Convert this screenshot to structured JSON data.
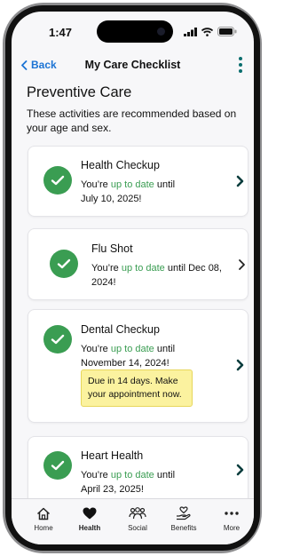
{
  "status": {
    "time": "1:47"
  },
  "nav": {
    "back_label": "Back",
    "title": "My Care Checklist"
  },
  "section": {
    "title": "Preventive Care",
    "intro": "These activities are recommended based on your age and sex."
  },
  "cards": [
    {
      "title": "Health Checkup",
      "status_prefix": "You’re ",
      "status_highlight": "up to date",
      "status_suffix": " until",
      "date": "July 10, 2025!"
    },
    {
      "title": "Flu Shot",
      "status_prefix": "You’re ",
      "status_highlight": "up to date",
      "status_suffix": " until Dec 08,",
      "date": "2024!"
    },
    {
      "title": "Dental Checkup",
      "status_prefix": "You’re ",
      "status_highlight": "up to date",
      "status_suffix": " until",
      "date": "November 14, 2024!",
      "due_line1": "Due in 14 days. Make",
      "due_line2": "your appointment now."
    },
    {
      "title": "Heart Health",
      "status_prefix": "You’re ",
      "status_highlight": "up to date",
      "status_suffix": " until",
      "date": "April 23, 2025!"
    }
  ],
  "tabs": [
    {
      "label": "Home",
      "icon": "home-icon"
    },
    {
      "label": "Health",
      "icon": "heart-icon",
      "active": true
    },
    {
      "label": "Social",
      "icon": "people-icon"
    },
    {
      "label": "Benefits",
      "icon": "hand-heart-icon"
    },
    {
      "label": "More",
      "icon": "more-icon"
    }
  ],
  "colors": {
    "accent_blue": "#1b73d4",
    "check_green": "#3a9d52",
    "teal": "#0a6e6e",
    "due_yellow": "#fbf29f"
  }
}
